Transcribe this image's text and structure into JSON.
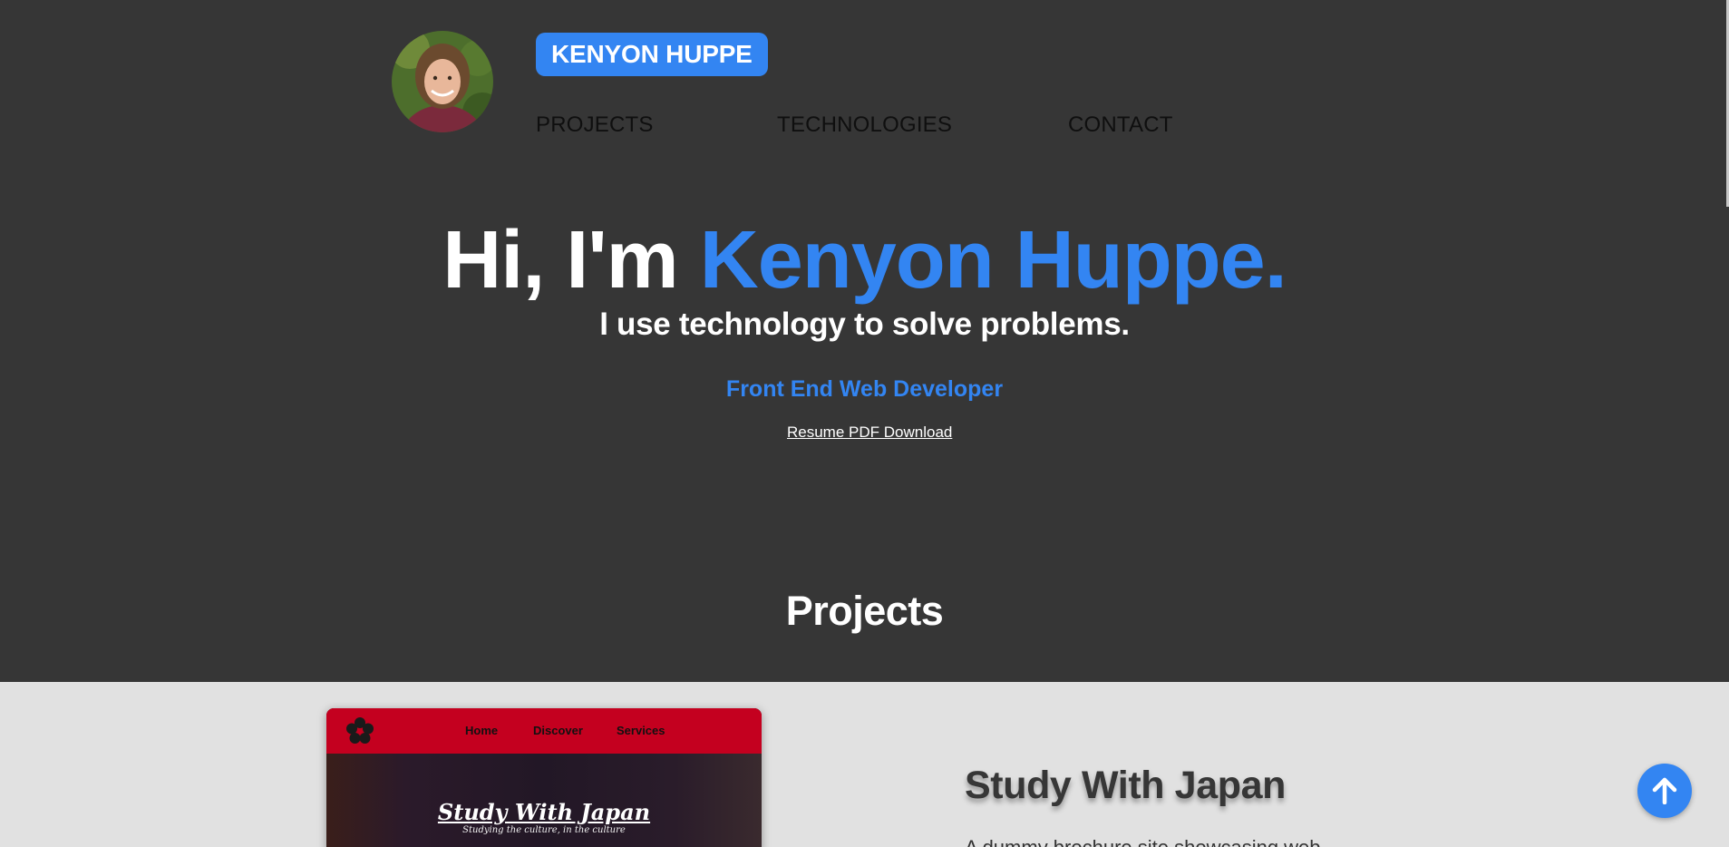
{
  "header": {
    "brand": "KENYON HUPPE",
    "avatar_icon": "profile-photo",
    "nav": {
      "projects": "PROJECTS",
      "technologies": "TECHNOLOGIES",
      "contact": "CONTACT"
    }
  },
  "hero": {
    "greeting": "Hi, I'm",
    "name": "Kenyon Huppe.",
    "tagline": "I use technology to solve problems.",
    "role": "Front End Web Developer",
    "resume_link": "Resume PDF Download"
  },
  "projects": {
    "section_title": "Projects",
    "items": [
      {
        "title": "Study With Japan",
        "description": "A dummy brochure site showcasing web",
        "thumbnail": {
          "nav": [
            "Home",
            "Discover",
            "Services"
          ],
          "headline": "Study With Japan",
          "subline": "Studying the culture, in the culture"
        }
      }
    ]
  },
  "scroll_top_icon": "arrow-up-icon",
  "colors": {
    "accent": "#3385f2",
    "dark_bg": "#363636",
    "light_bg": "#e1e1e1",
    "thumb_red": "#c4001f"
  }
}
